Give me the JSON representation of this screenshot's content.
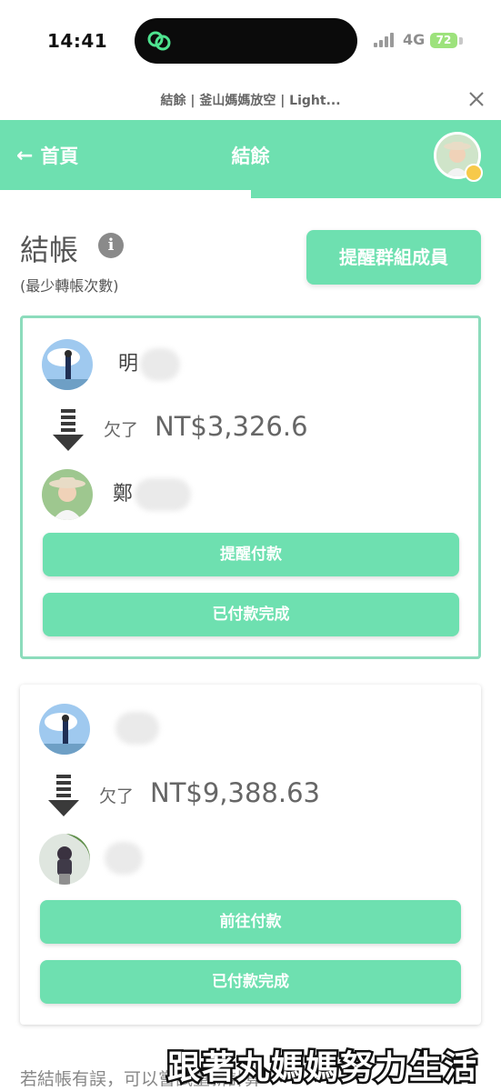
{
  "status_bar": {
    "time": "14:41",
    "network": "4G",
    "battery": "72"
  },
  "browser": {
    "title": "結餘 | 釜山媽媽放空 | Light..."
  },
  "header": {
    "back_label": "首頁",
    "title": "結餘"
  },
  "settle": {
    "title": "結帳",
    "subtitle": "(最少轉帳次數)",
    "remind_group_label": "提醒群組成員"
  },
  "cards": [
    {
      "debtor_name": "明",
      "owe_label": "欠了",
      "amount": "NT$3,326.6",
      "creditor_name": "鄭",
      "primary_action": "提醒付款",
      "secondary_action": "已付款完成"
    },
    {
      "debtor_name": "",
      "owe_label": "欠了",
      "amount": "NT$9,388.63",
      "creditor_name": "",
      "primary_action": "前往付款",
      "secondary_action": "已付款完成"
    }
  ],
  "footer": {
    "note": "若結帳有誤，可以嘗試重新計算"
  },
  "watermark": {
    "text": "跟著丸媽媽努力生活"
  },
  "colors": {
    "accent": "#6ee0b0",
    "card_border": "#8cdcbc",
    "text_muted": "#666666"
  },
  "icons": [
    "loop-icon",
    "signal-icon",
    "battery-icon",
    "close-icon",
    "back-arrow-icon",
    "gear-icon",
    "info-icon",
    "down-arrow-icon"
  ]
}
